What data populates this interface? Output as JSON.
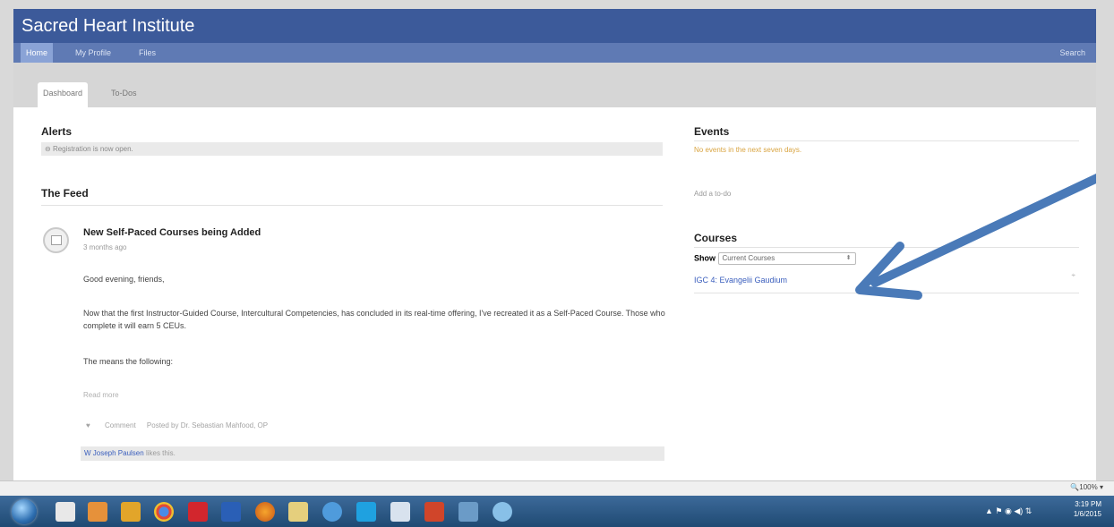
{
  "app": {
    "title": "Sacred Heart Institute",
    "nav": {
      "home": "Home",
      "profile": "My Profile",
      "files": "Files",
      "search": "Search"
    },
    "tabs": {
      "dashboard": "Dashboard",
      "todos": "To-Dos"
    }
  },
  "alerts": {
    "heading": "Alerts",
    "message": "Registration is now open."
  },
  "feed": {
    "heading": "The Feed",
    "post": {
      "title": "New Self-Paced Courses being Added",
      "time": "3 months ago",
      "p1": "Good evening, friends,",
      "p2": "Now that the first Instructor-Guided Course, Intercultural Competencies, has concluded in its real-time offering, I've recreated it as a Self-Paced Course. Those who complete it will earn 5 CEUs.",
      "p3": "The means the following:",
      "read_more": "Read more",
      "comment": "Comment",
      "posted_by": "Posted by Dr. Sebastian Mahfood, OP",
      "liked_by": "W Joseph Paulsen",
      "liked_suffix": "likes this."
    }
  },
  "events": {
    "heading": "Events",
    "empty": "No events in the next seven days."
  },
  "todo": {
    "add": "Add a to-do"
  },
  "courses": {
    "heading": "Courses",
    "show_label": "Show",
    "select_value": "Current Courses",
    "items": [
      {
        "name": "IGC 4: Evangelii Gaudium"
      }
    ]
  },
  "browser": {
    "zoom": "100%"
  },
  "taskbar": {
    "time": "3:19 PM",
    "date": "1/6/2015"
  },
  "colors": {
    "header": "#3c5a9a",
    "nav": "#5f7ab4",
    "arrow": "#4a7ab8",
    "link": "#3a5ebd",
    "events_empty": "#d9a441"
  }
}
